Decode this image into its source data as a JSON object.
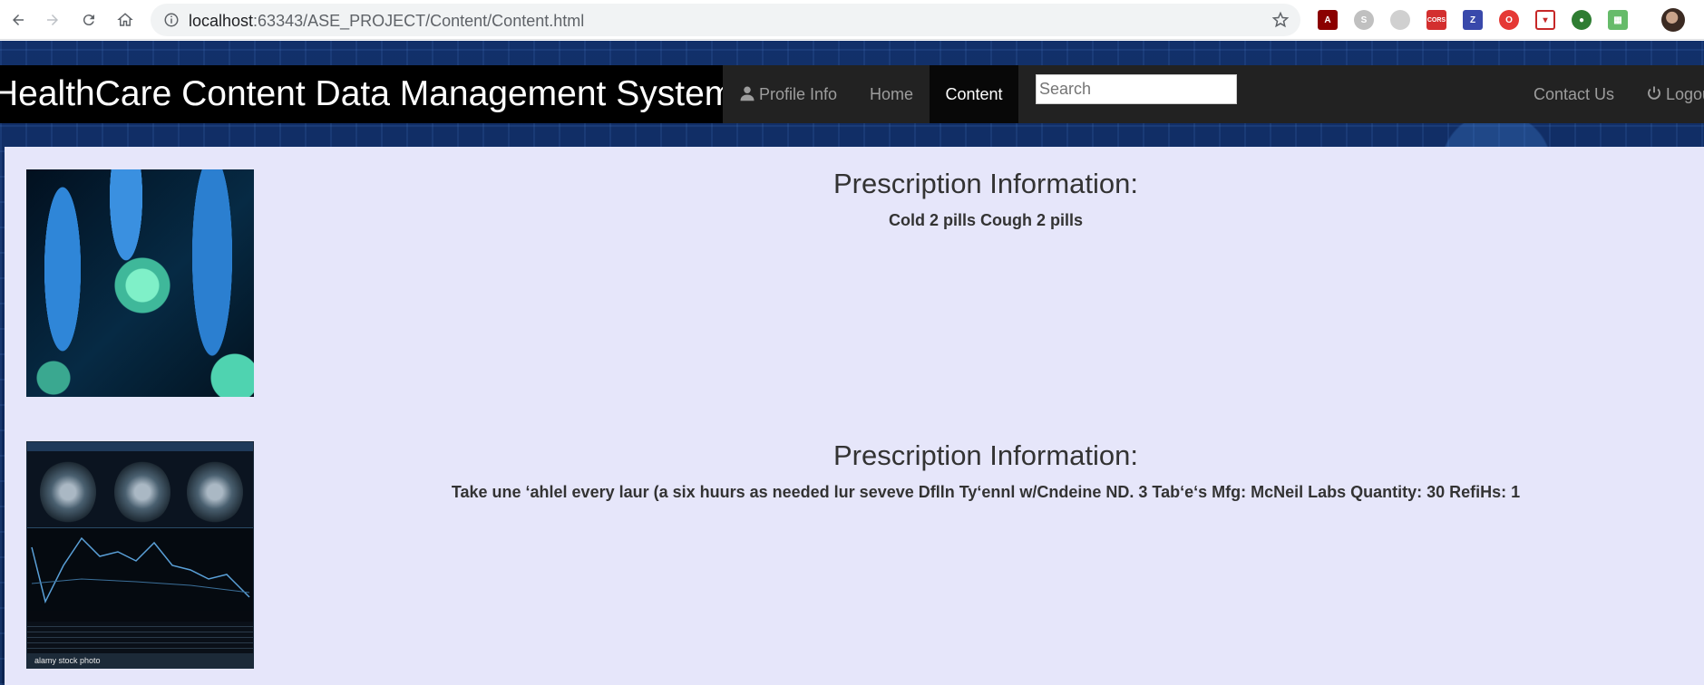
{
  "browser": {
    "url_host": "localhost",
    "url_path": ":63343/ASE_PROJECT/Content/Content.html"
  },
  "navbar": {
    "brand": "HealthCare Content Data Management System",
    "items": [
      {
        "label": "Profile Info"
      },
      {
        "label": "Home"
      },
      {
        "label": "Content"
      }
    ],
    "search_placeholder": "Search",
    "contact_label": "Contact Us",
    "logout_label": "Logout"
  },
  "entries": [
    {
      "title": "Prescription Information:",
      "body": "Cold 2 pills Cough 2 pills",
      "image": "bacteria-illustration"
    },
    {
      "title": "Prescription Information:",
      "body": "Take une ‘ahlel every laur (a six huurs as needed lur seveve Dflln Ty‘ennl w/Cndeine ND. 3 Tab‘e‘s Mfg: McNeil Labs Quantity: 30 RefiHs: 1",
      "image": "brain-scan-stock-photo",
      "watermark": "alamy stock photo"
    }
  ],
  "colors": {
    "navbar_bg": "#222222",
    "brand_bg": "#000000",
    "content_bg": "#e6e6fa",
    "active_item_bg": "#080808"
  }
}
